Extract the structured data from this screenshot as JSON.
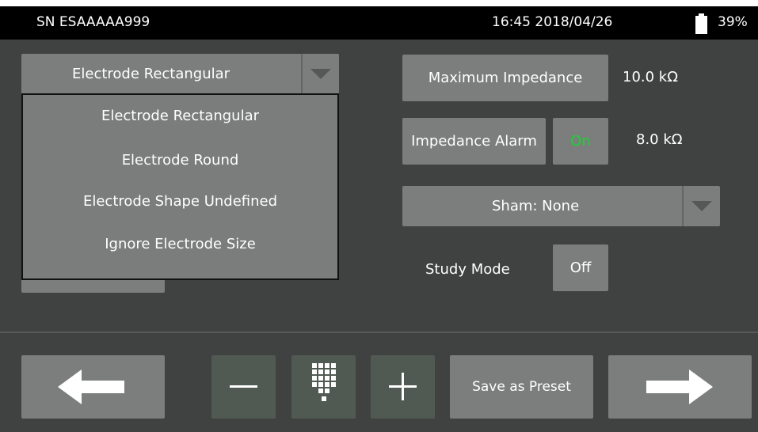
{
  "status": {
    "serial": "SN ESAAAAA999",
    "datetime": "16:45 2018/04/26",
    "battery": "39%"
  },
  "electrode": {
    "selected": "Electrode Rectangular",
    "options": [
      "Electrode Rectangular",
      "Electrode Round",
      "Electrode Shape Undefined",
      "Ignore Electrode Size"
    ]
  },
  "impedance": {
    "max_label": "Maximum Impedance",
    "max_value": "10.0 kΩ",
    "alarm_label": "Impedance Alarm",
    "alarm_state": "On",
    "alarm_value": "8.0 kΩ"
  },
  "sham": {
    "selected": "Sham: None"
  },
  "study": {
    "label": "Study Mode",
    "state": "Off"
  },
  "footer": {
    "save_label": "Save as Preset"
  },
  "colors": {
    "background": "#3f4241",
    "button": "#7b7e7c",
    "on_green": "#19d431",
    "stepper": "#505a52"
  }
}
